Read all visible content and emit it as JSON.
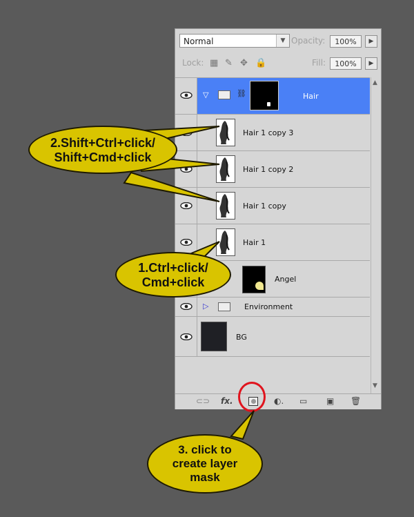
{
  "options": {
    "blend_mode": "Normal",
    "opacity_label": "Opacity:",
    "opacity_value": "100%",
    "lock_label": "Lock:",
    "fill_label": "Fill:",
    "fill_value": "100%"
  },
  "layers": [
    {
      "name": "Hair",
      "type": "group",
      "selected": true,
      "expanded": true
    },
    {
      "name": "Hair 1 copy 3",
      "type": "layer"
    },
    {
      "name": "Hair 1 copy 2",
      "type": "layer"
    },
    {
      "name": "Hair 1 copy",
      "type": "layer"
    },
    {
      "name": "Hair 1",
      "type": "layer"
    },
    {
      "name": "Angel",
      "type": "layer-with-mask"
    },
    {
      "name": "Environment",
      "type": "group",
      "expanded": false
    },
    {
      "name": "BG",
      "type": "layer"
    }
  ],
  "callouts": {
    "one": "1.Ctrl+click/\nCmd+click",
    "two": "2.Shift+Ctrl+click/\nShift+Cmd+click",
    "three": "3. click to\ncreate layer\nmask"
  },
  "bottom_icons": [
    "link-icon",
    "fx-icon",
    "add-mask-icon",
    "adjustment-icon",
    "new-group-icon",
    "new-layer-icon",
    "trash-icon"
  ],
  "colors": {
    "selection": "#4a80f6",
    "callout_fill": "#d9c400",
    "highlight_ring": "#e0141e"
  }
}
